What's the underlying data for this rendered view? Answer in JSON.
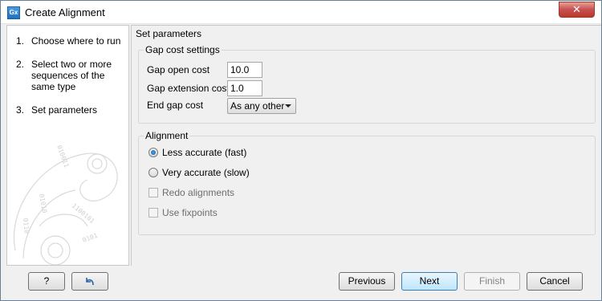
{
  "window": {
    "title": "Create Alignment",
    "app_icon_text": "Gx",
    "close_glyph": "✕"
  },
  "steps": [
    {
      "num": "1.",
      "label": "Choose where to run"
    },
    {
      "num": "2.",
      "label": "Select two or more sequences of the same type"
    },
    {
      "num": "3.",
      "label": "Set parameters"
    }
  ],
  "main": {
    "title": "Set parameters",
    "gap_group": {
      "title": "Gap cost settings",
      "gap_open_label": "Gap open cost",
      "gap_open_value": "10.0",
      "gap_ext_label": "Gap extension cost",
      "gap_ext_value": "1.0",
      "end_gap_label": "End gap cost",
      "end_gap_value": "As any other"
    },
    "align_group": {
      "title": "Alignment",
      "less_accurate_label": "Less accurate (fast)",
      "less_accurate_checked": true,
      "very_accurate_label": "Very accurate (slow)",
      "very_accurate_checked": false,
      "redo_label": "Redo alignments",
      "redo_checked": false,
      "fixpoints_label": "Use fixpoints",
      "fixpoints_checked": false
    }
  },
  "buttons": {
    "help": "?",
    "reset_icon": "reset-arrow-icon",
    "previous": "Previous",
    "next": "Next",
    "finish": "Finish",
    "cancel": "Cancel"
  }
}
